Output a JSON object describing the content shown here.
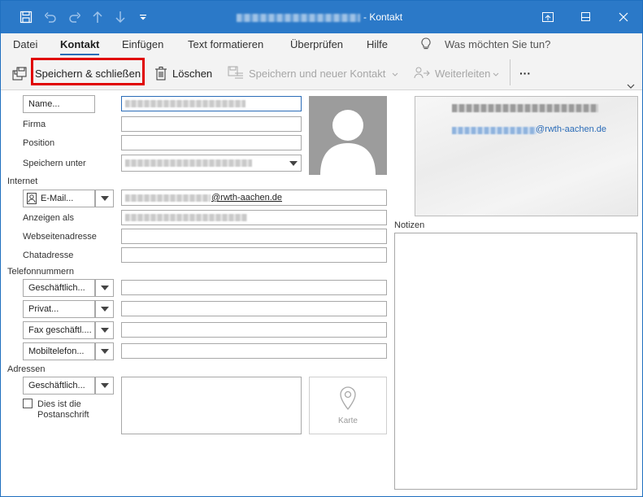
{
  "titlebar": {
    "title": "- Kontakt",
    "icons": [
      "save-icon",
      "undo-icon",
      "redo-icon",
      "up-arrow-icon",
      "down-arrow-icon",
      "customize-qat-icon"
    ],
    "controls": [
      "ribbon-display-icon",
      "minimize-icon",
      "maximize-icon",
      "close-icon"
    ]
  },
  "tabs": [
    "Datei",
    "Kontakt",
    "Einfügen",
    "Text formatieren",
    "Überprüfen",
    "Hilfe"
  ],
  "tell_me": "Was möchten Sie tun?",
  "ribbon": {
    "save_close": "Speichern & schließen",
    "delete": "Löschen",
    "save_new": "Speichern und neuer Kontakt",
    "forward": "Weiterleiten",
    "more": "···"
  },
  "form": {
    "name_button": "Name...",
    "firma": "Firma",
    "position": "Position",
    "speichern_unter": "Speichern unter",
    "internet": "Internet",
    "email_button": "E-Mail...",
    "email_value": "@rwth-aachen.de",
    "anzeigen_als": "Anzeigen als",
    "webseitenadresse": "Webseitenadresse",
    "chatadresse": "Chatadresse",
    "telefonnummern": "Telefonnummern",
    "phones": [
      "Geschäftlich...",
      "Privat...",
      "Fax geschäftl....",
      "Mobiltelefon..."
    ],
    "adressen": "Adressen",
    "address_button": "Geschäftlich...",
    "postanschrift": "Dies ist die Postanschrift",
    "karte": "Karte",
    "notizen": "Notizen"
  },
  "card": {
    "email": "@rwth-aachen.de"
  }
}
